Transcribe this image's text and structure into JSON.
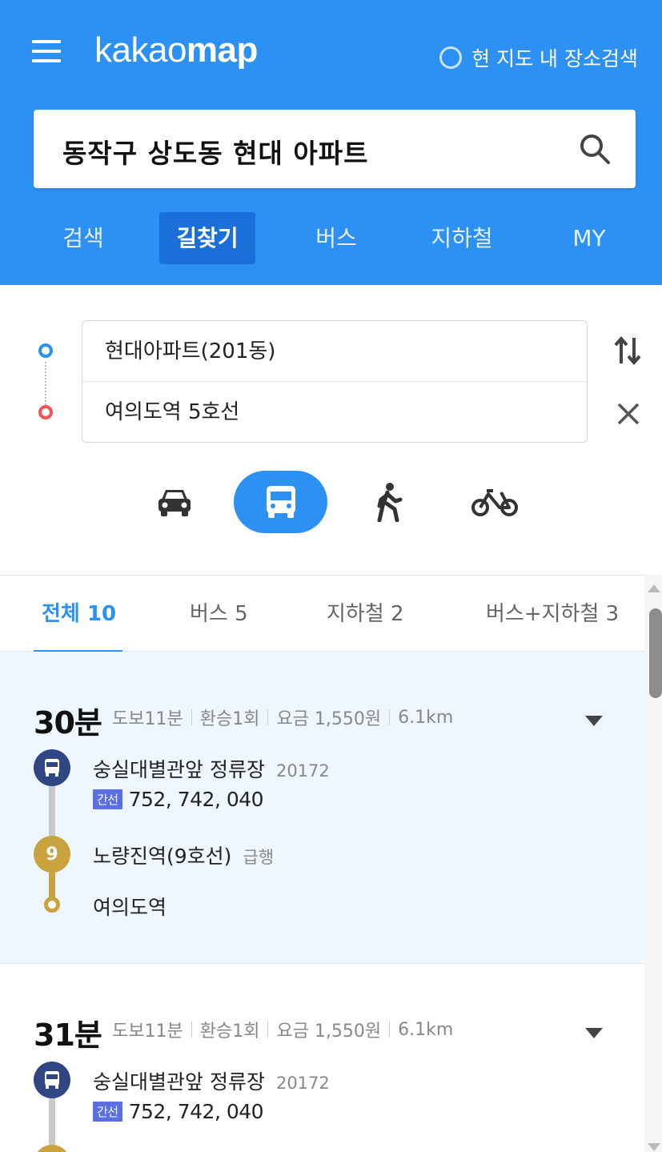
{
  "header": {
    "logo_kakao": "kakao",
    "logo_map": "map",
    "nearby_search_label": "현 지도 내 장소검색",
    "search_query": "동작구 상도동 현대 아파트",
    "accent_color": "#2d91f4"
  },
  "nav": {
    "items": [
      {
        "label": "검색",
        "active": false
      },
      {
        "label": "길찾기",
        "active": true
      },
      {
        "label": "버스",
        "active": false
      },
      {
        "label": "지하철",
        "active": false
      },
      {
        "label": "MY",
        "active": false
      }
    ]
  },
  "route": {
    "origin": "현대아파트(201동)",
    "destination": "여의도역 5호선",
    "modes": [
      {
        "name": "car-icon",
        "active": false
      },
      {
        "name": "bus-icon",
        "active": true
      },
      {
        "name": "walk-icon",
        "active": false
      },
      {
        "name": "bicycle-icon",
        "active": false
      }
    ]
  },
  "filter_tabs": [
    {
      "label": "전체 10",
      "active": true
    },
    {
      "label": "버스 5",
      "active": false
    },
    {
      "label": "지하철 2",
      "active": false
    },
    {
      "label": "버스+지하철 3",
      "active": false
    }
  ],
  "results": [
    {
      "time": "30분",
      "walk": "도보11분",
      "transfer": "환승1회",
      "fare": "요금 1,550원",
      "distance": "6.1km",
      "steps": {
        "bus_stop": "숭실대별관앞 정류장",
        "bus_stop_id": "20172",
        "bus_badge": "간선",
        "bus_numbers": "752, 742, 040",
        "subway_line_number": "9",
        "subway_station": "노량진역(9호선)",
        "subway_type": "급행",
        "destination": "여의도역"
      }
    },
    {
      "time": "31분",
      "walk": "도보11분",
      "transfer": "환승1회",
      "fare": "요금 1,550원",
      "distance": "6.1km",
      "steps": {
        "bus_stop": "숭실대별관앞 정류장",
        "bus_stop_id": "20172",
        "bus_badge": "간선",
        "bus_numbers": "752, 742, 040"
      }
    }
  ]
}
